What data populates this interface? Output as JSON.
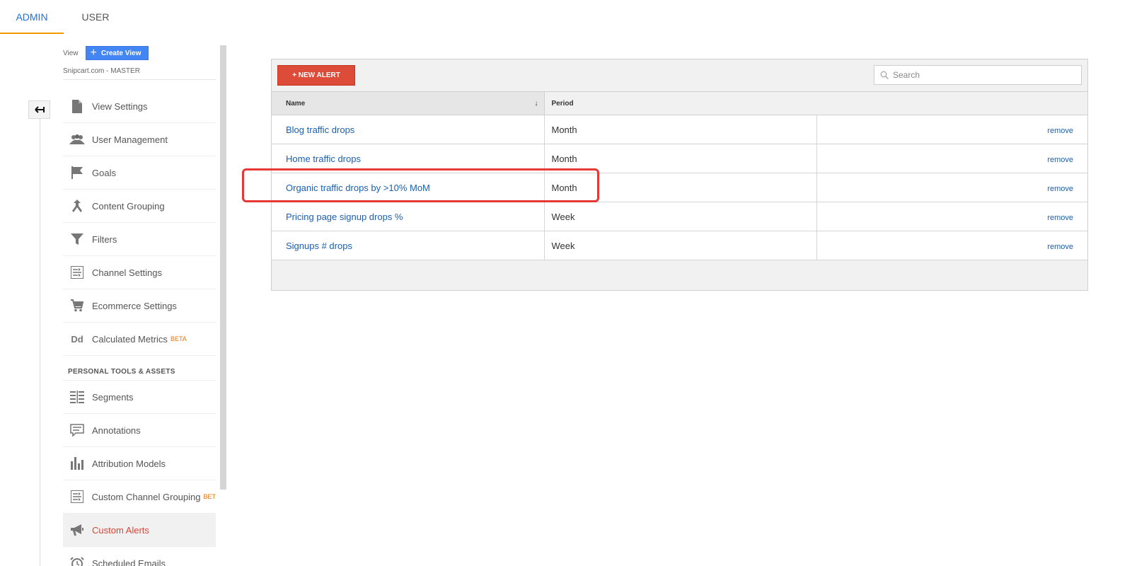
{
  "tabs": [
    {
      "label": "ADMIN",
      "active": true
    },
    {
      "label": "USER",
      "active": false
    }
  ],
  "view": {
    "label": "View",
    "create_button": "Create View",
    "name": "Snipcart.com - MASTER"
  },
  "menu": [
    {
      "label": "View Settings",
      "icon": "document-icon"
    },
    {
      "label": "User Management",
      "icon": "people-icon"
    },
    {
      "label": "Goals",
      "icon": "flag-icon"
    },
    {
      "label": "Content Grouping",
      "icon": "merge-icon"
    },
    {
      "label": "Filters",
      "icon": "funnel-icon"
    },
    {
      "label": "Channel Settings",
      "icon": "channel-icon"
    },
    {
      "label": "Ecommerce Settings",
      "icon": "cart-icon"
    },
    {
      "label": "Calculated Metrics",
      "icon": "dd-icon",
      "badge": "BETA"
    }
  ],
  "personal": {
    "heading": "PERSONAL TOOLS & ASSETS",
    "items": [
      {
        "label": "Segments",
        "icon": "segments-icon"
      },
      {
        "label": "Annotations",
        "icon": "comment-icon"
      },
      {
        "label": "Attribution Models",
        "icon": "bar-chart-icon"
      },
      {
        "label": "Custom Channel Grouping",
        "icon": "channel-icon",
        "badge": "BET"
      },
      {
        "label": "Custom Alerts",
        "icon": "megaphone-icon",
        "active": true
      },
      {
        "label": "Scheduled Emails",
        "icon": "alarm-clock-icon"
      }
    ]
  },
  "alerts": {
    "new_button": "+ NEW ALERT",
    "search_placeholder": "Search",
    "columns": {
      "name": "Name",
      "period": "Period"
    },
    "remove_label": "remove",
    "rows": [
      {
        "name": "Blog traffic drops",
        "period": "Month"
      },
      {
        "name": "Home traffic drops",
        "period": "Month"
      },
      {
        "name": "Organic traffic drops by >10% MoM",
        "period": "Month",
        "highlighted": true
      },
      {
        "name": "Pricing page signup drops %",
        "period": "Week"
      },
      {
        "name": "Signups # drops",
        "period": "Week"
      }
    ]
  },
  "colors": {
    "accent_blue": "#1a73e8",
    "tab_underline": "#f29900",
    "new_alert_red": "#dd4b39",
    "highlight_red": "#e53935",
    "active_menu_text": "#db4437"
  }
}
